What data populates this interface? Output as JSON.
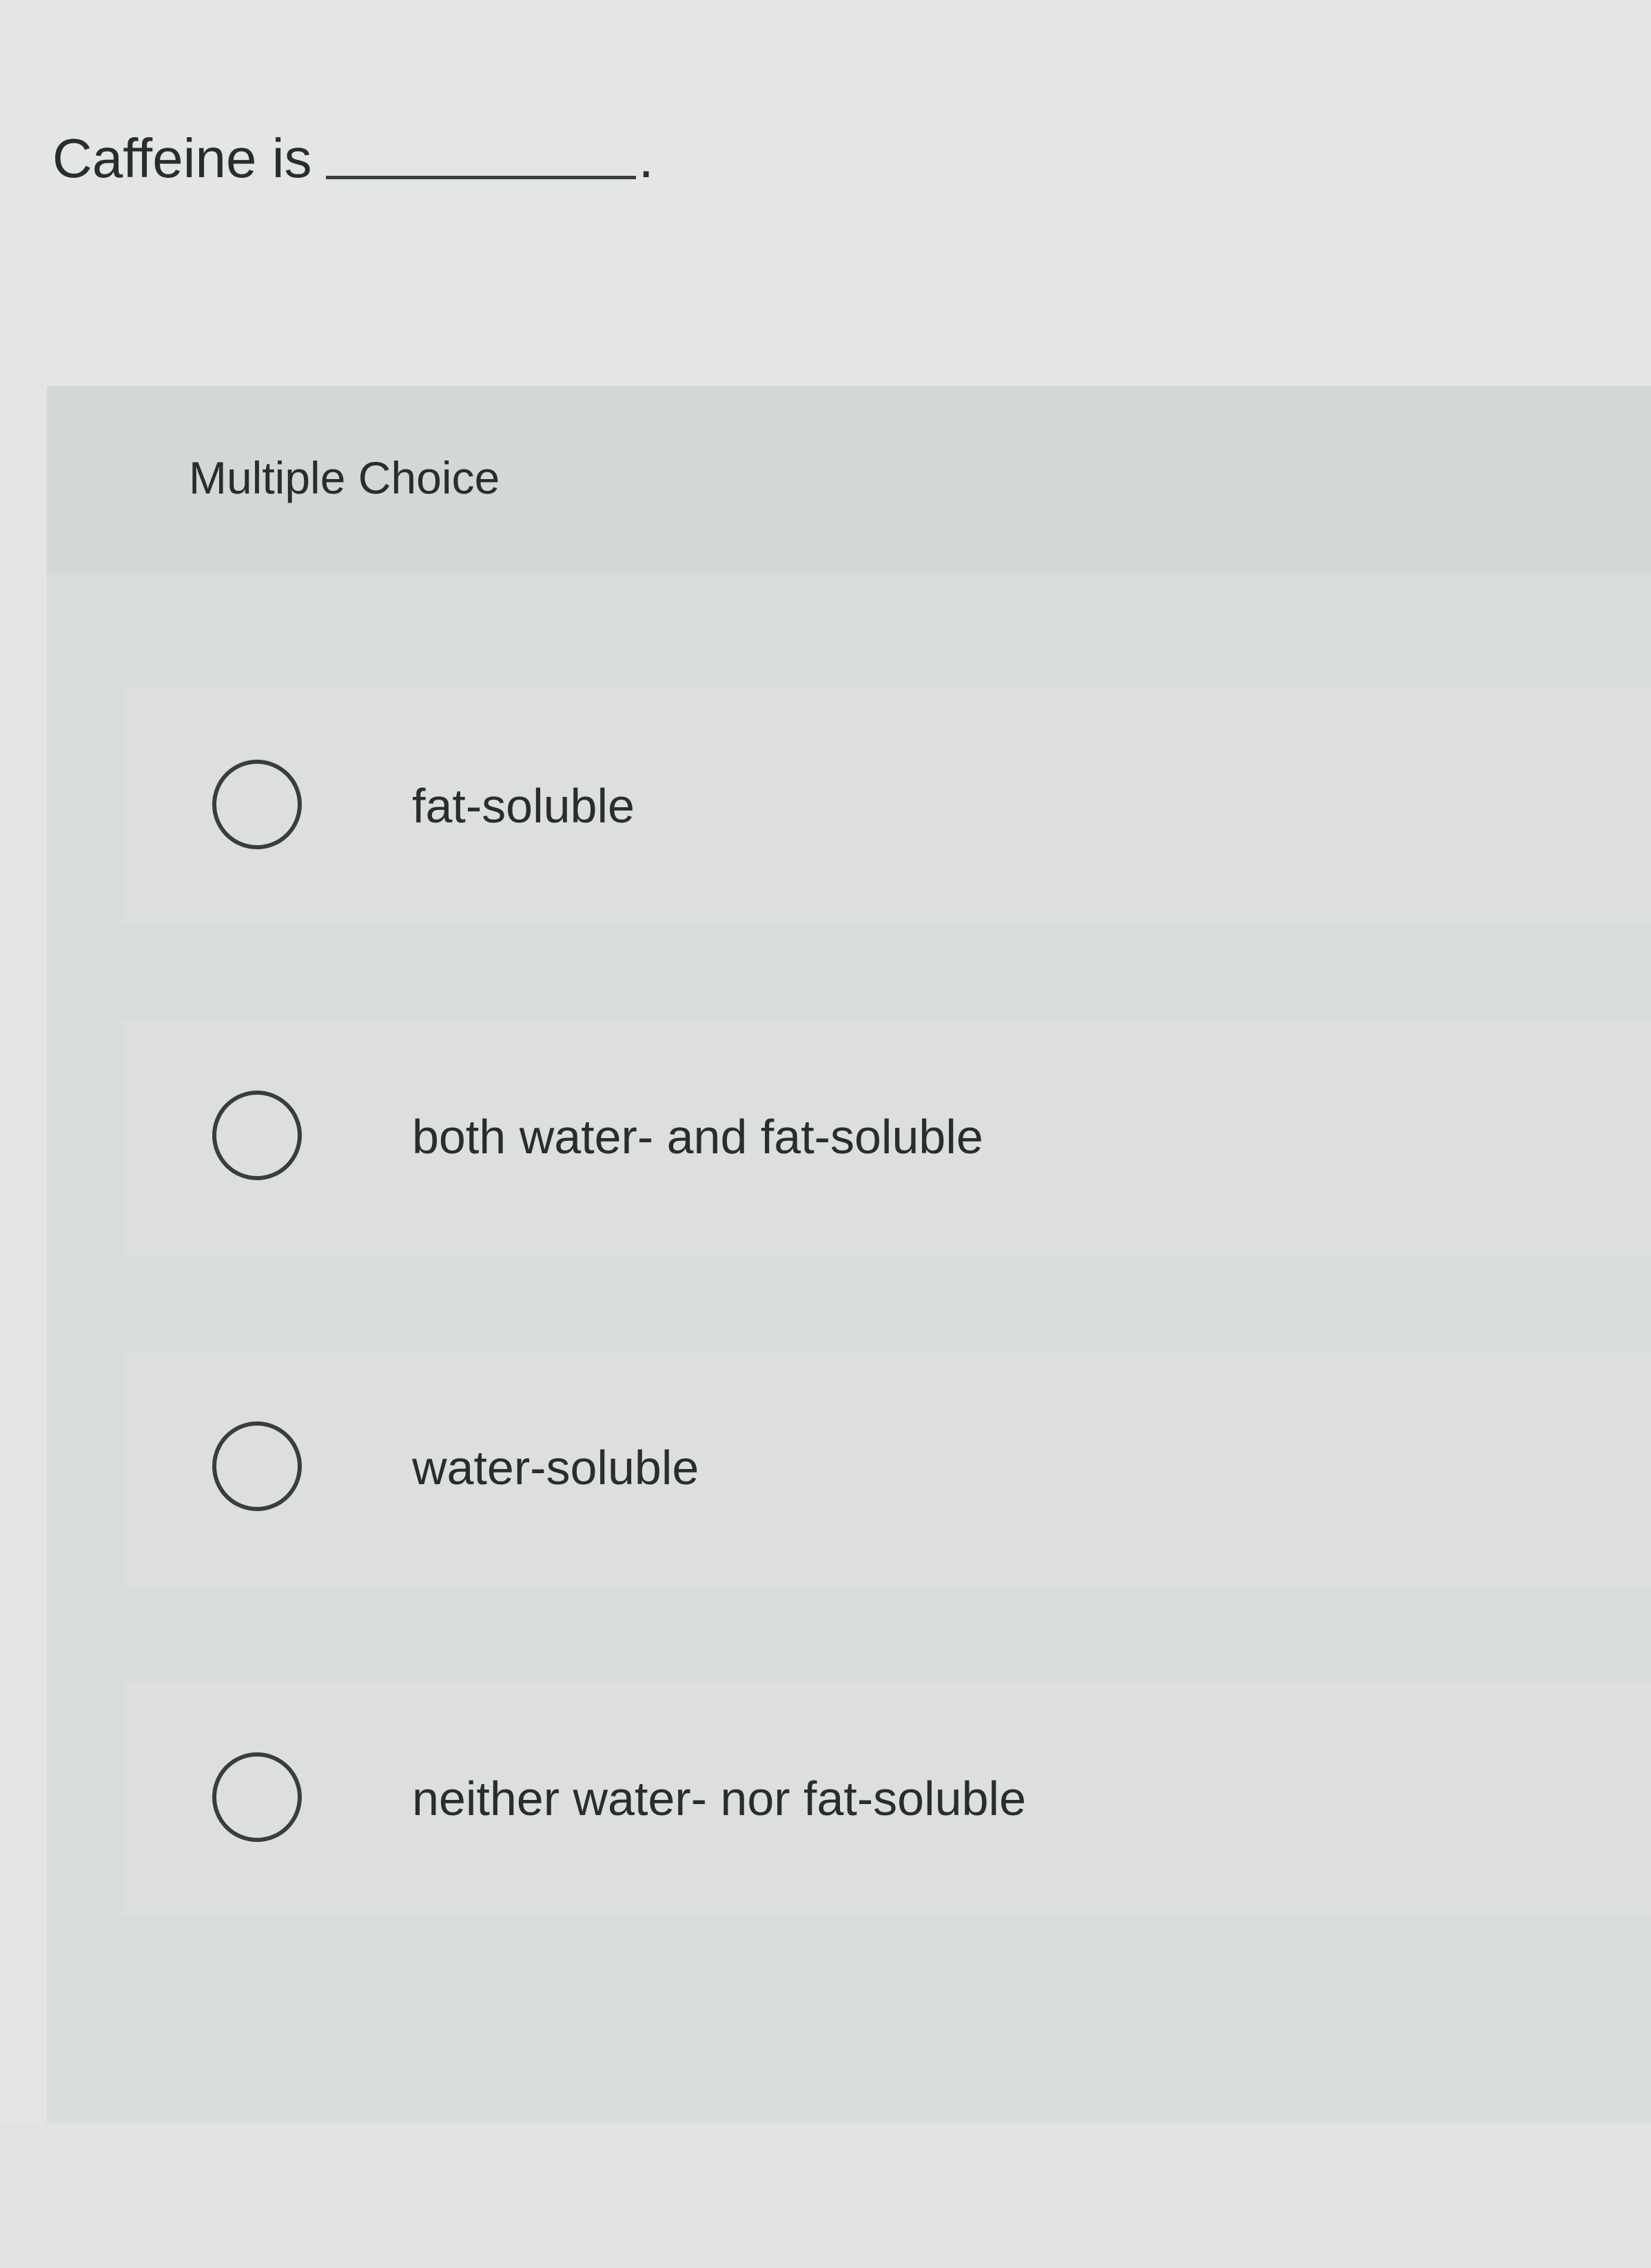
{
  "question": {
    "prefix": "Caffeine is",
    "suffix": "."
  },
  "panel": {
    "title": "Multiple Choice"
  },
  "options": [
    {
      "label": "fat-soluble",
      "selected": false
    },
    {
      "label": "both water- and fat-soluble",
      "selected": false
    },
    {
      "label": "water-soluble",
      "selected": false
    },
    {
      "label": "neither water- nor fat-soluble",
      "selected": false
    }
  ]
}
